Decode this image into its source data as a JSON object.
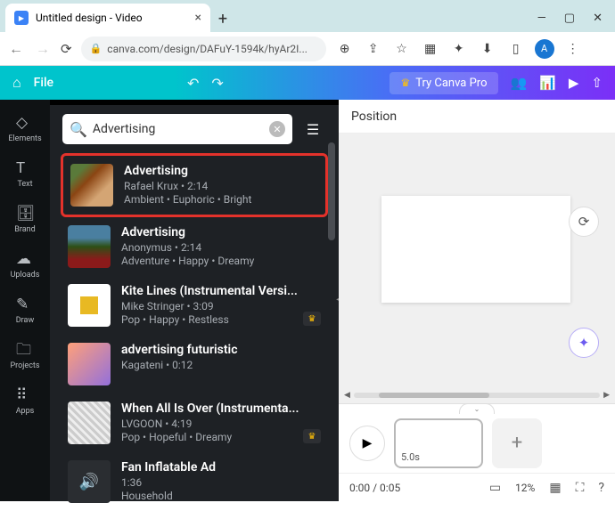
{
  "browser": {
    "tab_title": "Untitled design - Video",
    "url": "canva.com/design/DAFuY-1594k/hyAr2I...",
    "avatar_letter": "A"
  },
  "header": {
    "file_label": "File",
    "try_pro": "Try Canva Pro"
  },
  "rail": {
    "items": [
      {
        "label": "Elements"
      },
      {
        "label": "Text"
      },
      {
        "label": "Brand"
      },
      {
        "label": "Uploads"
      },
      {
        "label": "Draw"
      },
      {
        "label": "Projects"
      },
      {
        "label": "Apps"
      }
    ]
  },
  "search": {
    "value": "Advertising"
  },
  "tracks": [
    {
      "title": "Advertising",
      "artist": "Rafael Krux",
      "duration": "2:14",
      "tags": "Ambient • Euphoric • Bright",
      "pro": false,
      "highlight": true
    },
    {
      "title": "Advertising",
      "artist": "Anonymus",
      "duration": "2:14",
      "tags": "Adventure • Happy • Dreamy",
      "pro": false,
      "highlight": false
    },
    {
      "title": "Kite Lines (Instrumental Versi...",
      "artist": "Mike Stringer",
      "duration": "3:09",
      "tags": "Pop • Happy • Restless",
      "pro": true,
      "highlight": false
    },
    {
      "title": "advertising futuristic",
      "artist": "Kagateni",
      "duration": "0:12",
      "tags": "",
      "pro": false,
      "highlight": false
    },
    {
      "title": "When All Is Over (Instrumenta...",
      "artist": "LVGOON",
      "duration": "4:19",
      "tags": "Pop • Hopeful • Dreamy",
      "pro": true,
      "highlight": false
    },
    {
      "title": "Fan Inflatable Ad",
      "artist": "",
      "duration": "1:36",
      "tags": "Household",
      "pro": false,
      "highlight": false
    }
  ],
  "context_bar": {
    "position": "Position"
  },
  "timeline": {
    "clip_duration": "5.0s",
    "time_display": "0:00 / 0:05",
    "zoom": "12%"
  }
}
